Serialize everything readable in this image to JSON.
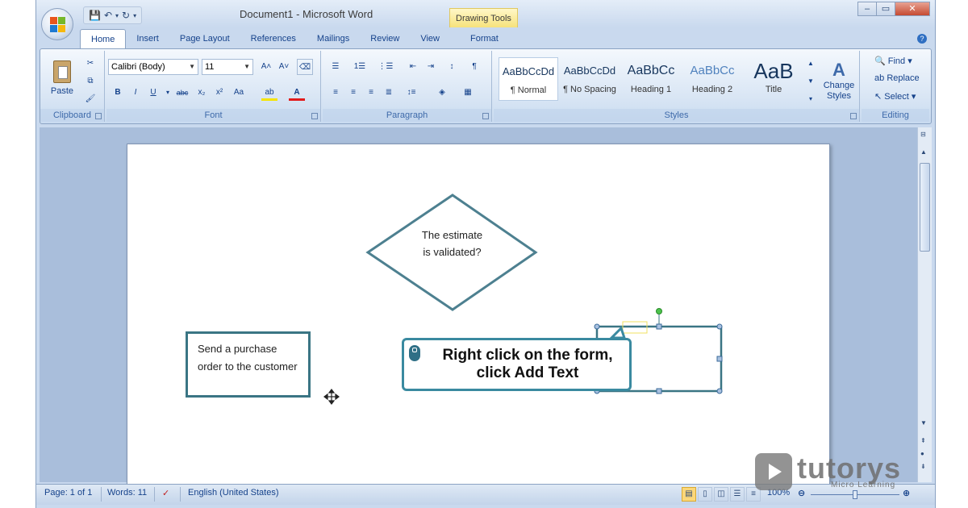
{
  "window": {
    "title": "Document1 - Microsoft Word",
    "contextual_tab_group": "Drawing Tools",
    "controls": [
      "–",
      "▭",
      "✕"
    ]
  },
  "tabs": [
    "Home",
    "Insert",
    "Page Layout",
    "References",
    "Mailings",
    "Review",
    "View"
  ],
  "contextual_tab": "Format",
  "active_tab": "Home",
  "clipboard": {
    "label": "Clipboard",
    "paste": "Paste"
  },
  "font": {
    "label": "Font",
    "name": "Calibri (Body)",
    "size": "11"
  },
  "paragraph": {
    "label": "Paragraph"
  },
  "styles": {
    "label": "Styles",
    "items": [
      {
        "preview": "AaBbCcDd",
        "name": "¶ Normal"
      },
      {
        "preview": "AaBbCcDd",
        "name": "¶ No Spacing"
      },
      {
        "preview": "AaBbCc",
        "name": "Heading 1"
      },
      {
        "preview": "AaBbCc",
        "name": "Heading 2"
      },
      {
        "preview": "AaB",
        "name": "Title"
      }
    ],
    "change_styles": "Change Styles"
  },
  "editing": {
    "label": "Editing",
    "find": "Find",
    "replace": "Replace",
    "select": "Select"
  },
  "document": {
    "diamond_text_line1": "The estimate",
    "diamond_text_line2": "is validated?",
    "rect_text": "Send a purchase order to the customer",
    "callout_text": "Right click on the form, click Add Text"
  },
  "statusbar": {
    "page": "Page: 1 of 1",
    "words": "Words: 11",
    "language": "English (United States)",
    "zoom": "100%"
  },
  "watermark": {
    "brand": "tutorys",
    "tagline": "Micro Learning"
  },
  "colors": {
    "shape_border": "#3a7584",
    "callout_border": "#3a8aa0",
    "ribbon_bg": "#dbe7f5"
  }
}
